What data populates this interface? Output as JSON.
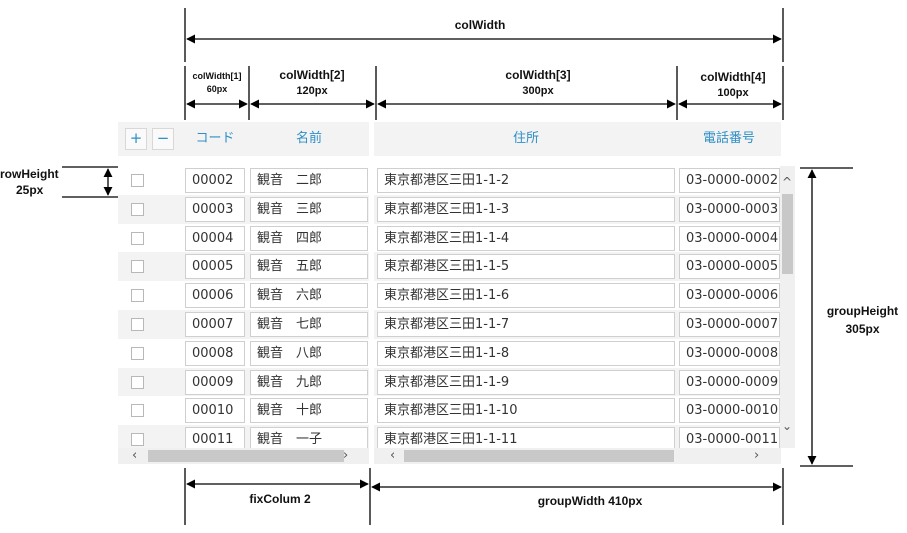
{
  "annotations": {
    "col_width_total": "colWidth",
    "col_width_1_label": "colWidth[1]",
    "col_width_1_value": "60px",
    "col_width_2_label": "colWidth[2]",
    "col_width_2_value": "120px",
    "col_width_3_label": "colWidth[3]",
    "col_width_3_value": "300px",
    "col_width_4_label": "colWidth[4]",
    "col_width_4_value": "100px",
    "row_height_label": "rowHeight",
    "row_height_value": "25px",
    "group_height_label": "groupHeight",
    "group_height_value": "305px",
    "fix_column_label": "fixColum 2",
    "group_width_label": "groupWidth 410px"
  },
  "grid": {
    "add_button": "+",
    "remove_button": "−",
    "headers": [
      "コード",
      "名前",
      "住所",
      "電話番号"
    ],
    "rows": [
      {
        "code": "00002",
        "name": "観音　二郎",
        "address": "東京都港区三田1-1-2",
        "phone": "03-0000-0002"
      },
      {
        "code": "00003",
        "name": "観音　三郎",
        "address": "東京都港区三田1-1-3",
        "phone": "03-0000-0003"
      },
      {
        "code": "00004",
        "name": "観音　四郎",
        "address": "東京都港区三田1-1-4",
        "phone": "03-0000-0004"
      },
      {
        "code": "00005",
        "name": "観音　五郎",
        "address": "東京都港区三田1-1-5",
        "phone": "03-0000-0005"
      },
      {
        "code": "00006",
        "name": "観音　六郎",
        "address": "東京都港区三田1-1-6",
        "phone": "03-0000-0006"
      },
      {
        "code": "00007",
        "name": "観音　七郎",
        "address": "東京都港区三田1-1-7",
        "phone": "03-0000-0007"
      },
      {
        "code": "00008",
        "name": "観音　八郎",
        "address": "東京都港区三田1-1-8",
        "phone": "03-0000-0008"
      },
      {
        "code": "00009",
        "name": "観音　九郎",
        "address": "東京都港区三田1-1-9",
        "phone": "03-0000-0009"
      },
      {
        "code": "00010",
        "name": "観音　十郎",
        "address": "東京都港区三田1-1-10",
        "phone": "03-0000-0010"
      },
      {
        "code": "00011",
        "name": "観音　一子",
        "address": "東京都港区三田1-1-11",
        "phone": "03-0000-0011"
      }
    ]
  },
  "colors": {
    "accent": "#2f8fc6",
    "header_bg": "#f3f3f3",
    "row_alt_bg": "#f3f3f3",
    "cell_border": "#cfcfcf"
  }
}
